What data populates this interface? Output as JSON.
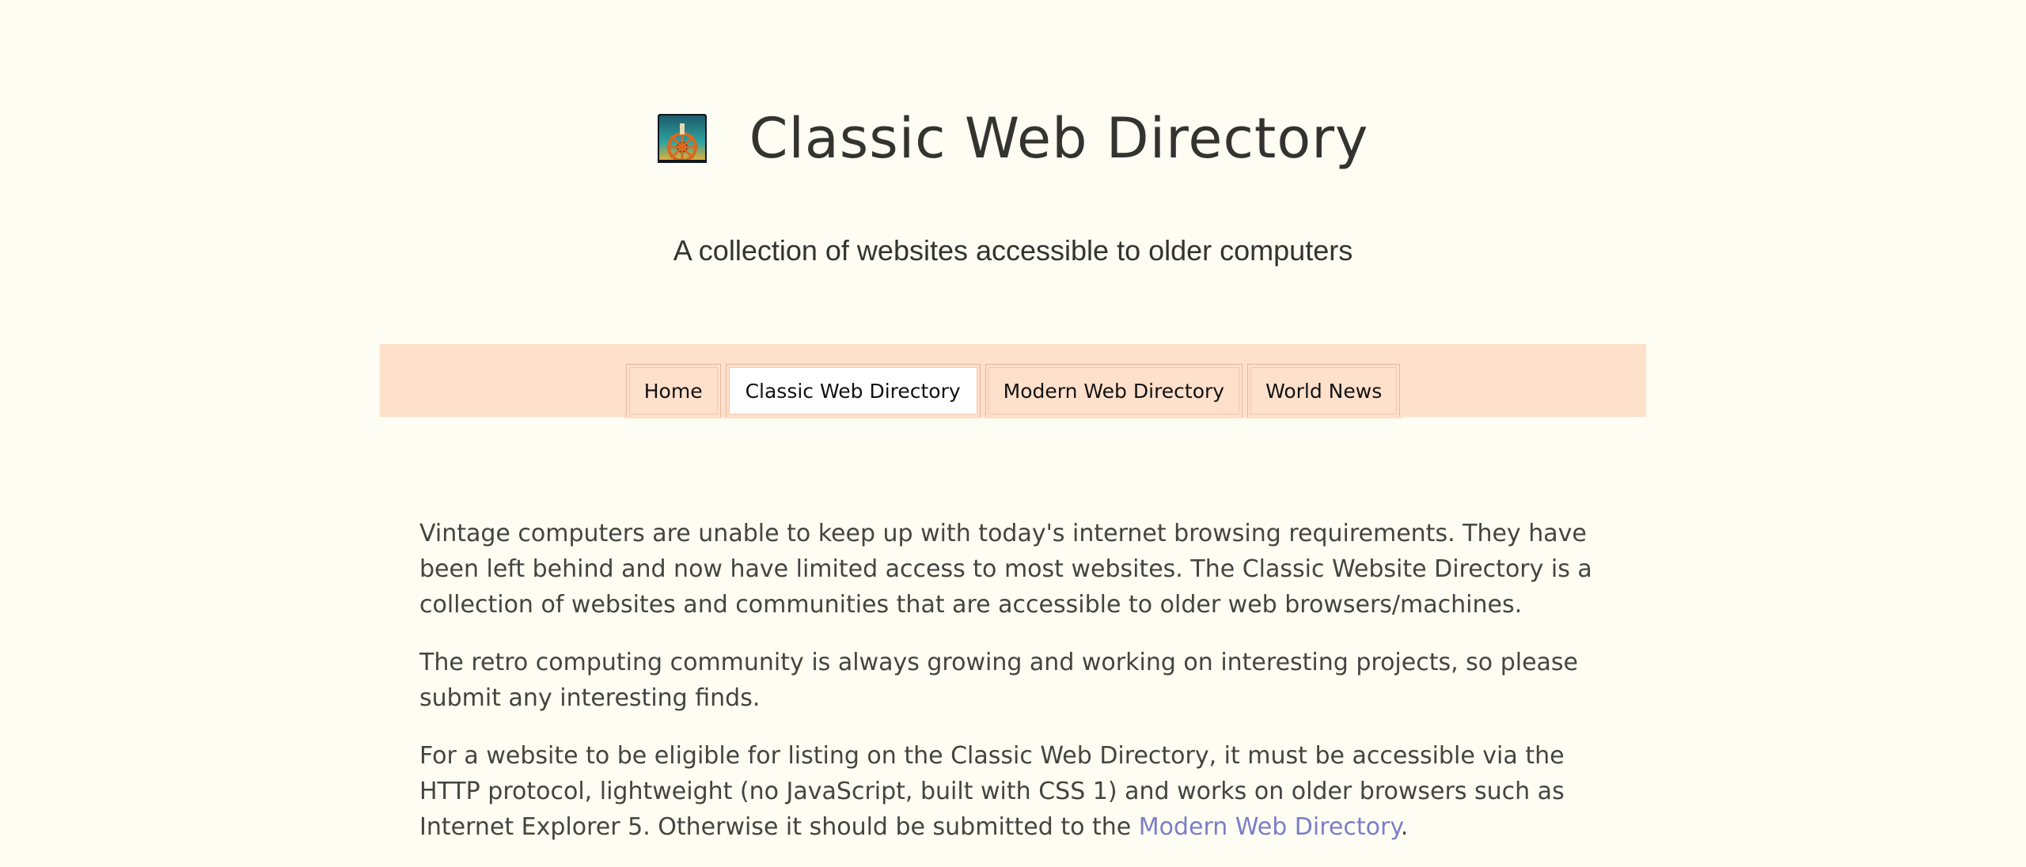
{
  "site": {
    "title": "Classic Web Directory",
    "tagline": "A collection of websites accessible to older computers",
    "logo_icon": "ship-wheel-icon"
  },
  "nav": {
    "tabs": [
      {
        "label": "Home",
        "active": false
      },
      {
        "label": "Classic Web Directory",
        "active": true
      },
      {
        "label": "Modern Web Directory",
        "active": false
      },
      {
        "label": "World News",
        "active": false
      }
    ]
  },
  "content": {
    "paragraph1": "Vintage computers are unable to keep up with today's internet browsing requirements. They have been left behind and now have limited access to most websites. The Classic Website Directory is a collection of websites and communities that are accessible to older web browsers/machines.",
    "paragraph2": "The retro computing community is always growing and working on interesting projects, so please submit any interesting finds.",
    "paragraph3_before": "For a website to be eligible for listing on the Classic Web Directory, it must be accessible via the HTTP protocol, lightweight (no JavaScript, built with CSS 1) and works on older browsers such as Internet Explorer 5. Otherwise it should be submitted to the ",
    "paragraph3_link": "Modern Web Directory",
    "paragraph3_after": "."
  },
  "colors": {
    "background": "#fdfdf3",
    "nav_background": "#ffe0cb",
    "link": "#7c7ec8",
    "text": "#333330"
  }
}
